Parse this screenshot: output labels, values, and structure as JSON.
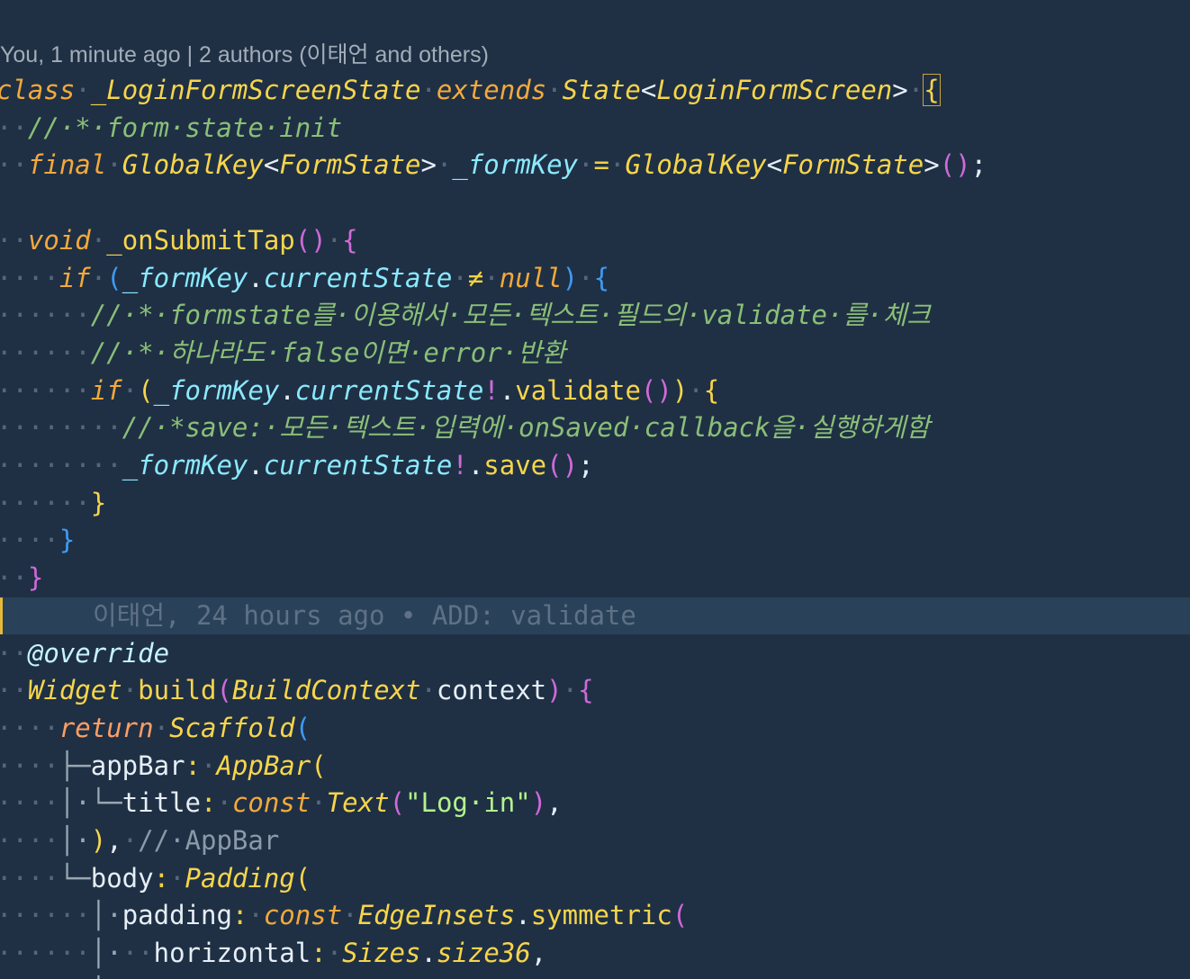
{
  "codelens": "You, 1 minute ago | 2 authors (이태언 and others)",
  "blame": "이태언, 24 hours ago • ADD: validate",
  "lines": [
    {
      "tokens": [
        [
          "kw",
          "class"
        ],
        [
          "ws",
          "·"
        ],
        [
          "ty",
          "_LoginFormScreenState"
        ],
        [
          "ws",
          "·"
        ],
        [
          "kw",
          "extends"
        ],
        [
          "ws",
          "·"
        ],
        [
          "ty",
          "State"
        ],
        [
          "id",
          "<"
        ],
        [
          "ty",
          "LoginFormScreen"
        ],
        [
          "id",
          ">"
        ],
        [
          "ws",
          "·"
        ],
        [
          "p1box",
          "{"
        ]
      ]
    },
    {
      "tokens": [
        [
          "ws",
          "··"
        ],
        [
          "cm",
          "//·*·form·state·init"
        ]
      ]
    },
    {
      "tokens": [
        [
          "ws",
          "··"
        ],
        [
          "kw",
          "final"
        ],
        [
          "ws",
          "·"
        ],
        [
          "ty",
          "GlobalKey"
        ],
        [
          "id",
          "<"
        ],
        [
          "ty",
          "FormState"
        ],
        [
          "id",
          ">"
        ],
        [
          "ws",
          "·"
        ],
        [
          "vr",
          "_formKey"
        ],
        [
          "ws",
          "·"
        ],
        [
          "op",
          "="
        ],
        [
          "ws",
          "·"
        ],
        [
          "ty",
          "GlobalKey"
        ],
        [
          "id",
          "<"
        ],
        [
          "ty",
          "FormState"
        ],
        [
          "id",
          ">"
        ],
        [
          "p2",
          "()"
        ],
        [
          "id",
          ";"
        ]
      ]
    },
    {
      "tokens": []
    },
    {
      "tokens": [
        [
          "ws",
          "··"
        ],
        [
          "kw",
          "void"
        ],
        [
          "ws",
          "·"
        ],
        [
          "fn",
          "_onSubmitTap"
        ],
        [
          "p2",
          "()"
        ],
        [
          "ws",
          "·"
        ],
        [
          "p2",
          "{"
        ]
      ]
    },
    {
      "tokens": [
        [
          "ws",
          "····"
        ],
        [
          "kw",
          "if"
        ],
        [
          "ws",
          "·"
        ],
        [
          "p3",
          "("
        ],
        [
          "vr",
          "_formKey"
        ],
        [
          "id",
          "."
        ],
        [
          "vr",
          "currentState"
        ],
        [
          "ws",
          "·"
        ],
        [
          "op",
          "≠"
        ],
        [
          "ws",
          "·"
        ],
        [
          "kw",
          "null"
        ],
        [
          "p3",
          ")"
        ],
        [
          "ws",
          "·"
        ],
        [
          "p3",
          "{"
        ]
      ]
    },
    {
      "tokens": [
        [
          "ws",
          "······"
        ],
        [
          "cm",
          "//·*·formstate를·이용해서·모든·텍스트·필드의·validate·를·체크"
        ]
      ]
    },
    {
      "tokens": [
        [
          "ws",
          "······"
        ],
        [
          "cm",
          "//·*·하나라도·false이면·error·반환"
        ]
      ]
    },
    {
      "tokens": [
        [
          "ws",
          "······"
        ],
        [
          "kw",
          "if"
        ],
        [
          "ws",
          "·"
        ],
        [
          "p1",
          "("
        ],
        [
          "vr",
          "_formKey"
        ],
        [
          "id",
          "."
        ],
        [
          "vr",
          "currentState"
        ],
        [
          "pk",
          "!"
        ],
        [
          "id",
          "."
        ],
        [
          "fn",
          "validate"
        ],
        [
          "p2",
          "()"
        ],
        [
          "p1",
          ")"
        ],
        [
          "ws",
          "·"
        ],
        [
          "p1",
          "{"
        ]
      ]
    },
    {
      "tokens": [
        [
          "ws",
          "········"
        ],
        [
          "cm",
          "//·*save:·모든·텍스트·입력에·onSaved·callback을·실행하게함"
        ]
      ]
    },
    {
      "tokens": [
        [
          "ws",
          "········"
        ],
        [
          "vr",
          "_formKey"
        ],
        [
          "id",
          "."
        ],
        [
          "vr",
          "currentState"
        ],
        [
          "pk",
          "!"
        ],
        [
          "id",
          "."
        ],
        [
          "fn",
          "save"
        ],
        [
          "p2",
          "()"
        ],
        [
          "id",
          ";"
        ]
      ]
    },
    {
      "tokens": [
        [
          "ws",
          "······"
        ],
        [
          "p1",
          "}"
        ]
      ]
    },
    {
      "tokens": [
        [
          "ws",
          "····"
        ],
        [
          "p3",
          "}"
        ]
      ]
    },
    {
      "tokens": [
        [
          "ws",
          "··"
        ],
        [
          "p2",
          "}"
        ]
      ]
    },
    {
      "blame": true
    },
    {
      "tokens": [
        [
          "ws",
          "··"
        ],
        [
          "an",
          "@override"
        ]
      ]
    },
    {
      "tokens": [
        [
          "ws",
          "··"
        ],
        [
          "ty",
          "Widget"
        ],
        [
          "ws",
          "·"
        ],
        [
          "fn",
          "build"
        ],
        [
          "p2",
          "("
        ],
        [
          "ty",
          "BuildContext"
        ],
        [
          "ws",
          "·"
        ],
        [
          "id",
          "context"
        ],
        [
          "p2",
          ")"
        ],
        [
          "ws",
          "·"
        ],
        [
          "p2",
          "{"
        ]
      ]
    },
    {
      "tokens": [
        [
          "ws",
          "····"
        ],
        [
          "kw2",
          "return"
        ],
        [
          "ws",
          "·"
        ],
        [
          "ty",
          "Scaffold"
        ],
        [
          "p3",
          "("
        ]
      ]
    },
    {
      "tokens": [
        [
          "ws",
          "····"
        ],
        [
          "tree",
          "├─"
        ],
        [
          "id",
          "appBar"
        ],
        [
          "op",
          ":"
        ],
        [
          "ws",
          "·"
        ],
        [
          "ty",
          "AppBar"
        ],
        [
          "p1",
          "("
        ]
      ]
    },
    {
      "tokens": [
        [
          "ws",
          "····"
        ],
        [
          "tree",
          "│·└─"
        ],
        [
          "id",
          "title"
        ],
        [
          "op",
          ":"
        ],
        [
          "ws",
          "·"
        ],
        [
          "kw",
          "const"
        ],
        [
          "ws",
          "·"
        ],
        [
          "ty",
          "Text"
        ],
        [
          "p2",
          "("
        ],
        [
          "st",
          "\"Log·in\""
        ],
        [
          "p2",
          ")"
        ],
        [
          "id",
          ","
        ]
      ]
    },
    {
      "tokens": [
        [
          "ws",
          "····"
        ],
        [
          "tree",
          "│·"
        ],
        [
          "p1",
          ")"
        ],
        [
          "id",
          ","
        ],
        [
          "ws",
          "·"
        ],
        [
          "cmg",
          "//·AppBar"
        ]
      ]
    },
    {
      "tokens": [
        [
          "ws",
          "····"
        ],
        [
          "tree",
          "└─"
        ],
        [
          "id",
          "body"
        ],
        [
          "op",
          ":"
        ],
        [
          "ws",
          "·"
        ],
        [
          "ty",
          "Padding"
        ],
        [
          "p1",
          "("
        ]
      ]
    },
    {
      "tokens": [
        [
          "ws",
          "······"
        ],
        [
          "tree",
          "│·"
        ],
        [
          "id",
          "padding"
        ],
        [
          "op",
          ":"
        ],
        [
          "ws",
          "·"
        ],
        [
          "kw",
          "const"
        ],
        [
          "ws",
          "·"
        ],
        [
          "ty",
          "EdgeInsets"
        ],
        [
          "id",
          "."
        ],
        [
          "fn",
          "symmetric"
        ],
        [
          "p2",
          "("
        ]
      ]
    },
    {
      "tokens": [
        [
          "ws",
          "······"
        ],
        [
          "tree",
          "│·"
        ],
        [
          "ws",
          "··"
        ],
        [
          "id",
          "horizontal"
        ],
        [
          "op",
          ":"
        ],
        [
          "ws",
          "·"
        ],
        [
          "ty",
          "Sizes"
        ],
        [
          "id",
          "."
        ],
        [
          "ty",
          "size36"
        ],
        [
          "id",
          ","
        ]
      ]
    },
    {
      "tokens": [
        [
          "ws",
          "······"
        ],
        [
          "tree",
          "│·"
        ],
        [
          "p2",
          ")"
        ],
        [
          "id",
          ","
        ]
      ]
    }
  ],
  "colors": {
    "background": "#1f3045",
    "blame_background": "#2a4259",
    "blame_border": "#e5b93a"
  }
}
